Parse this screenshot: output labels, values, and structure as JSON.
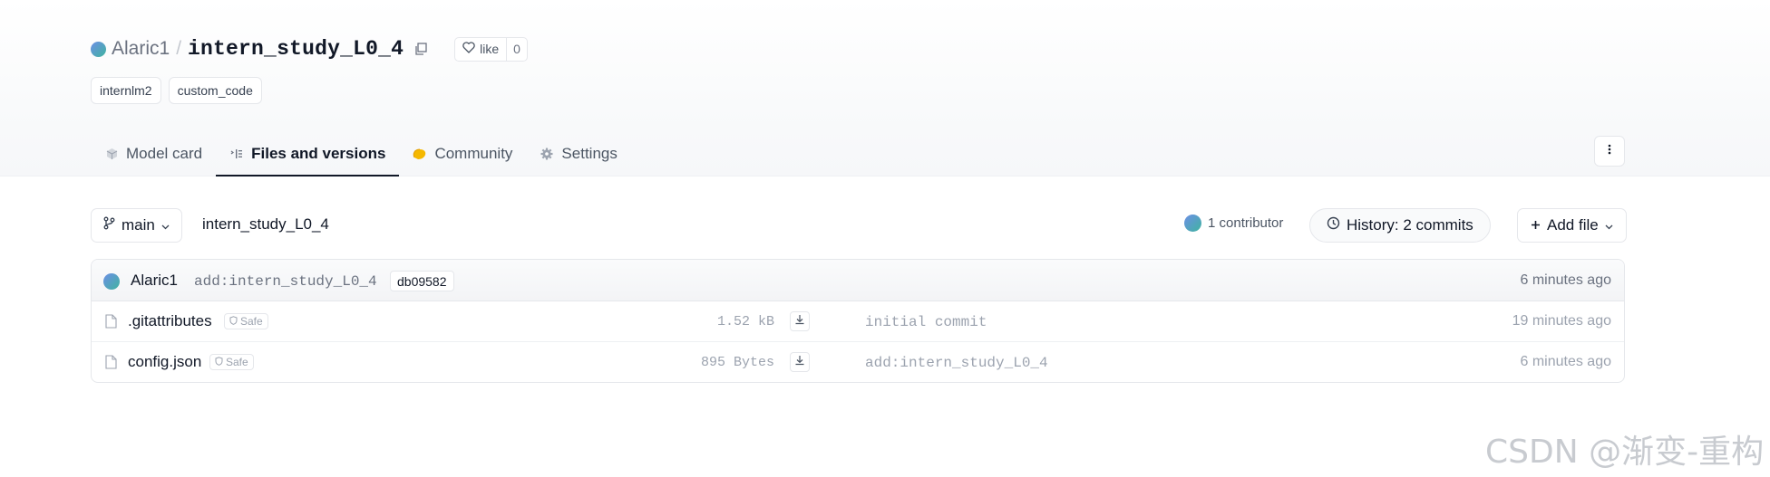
{
  "repo": {
    "owner": "Alaric1",
    "separator": "/",
    "name": "intern_study_L0_4",
    "like_label": "like",
    "like_count": "0"
  },
  "tags": [
    "internlm2",
    "custom_code"
  ],
  "tabs": [
    {
      "label": "Model card",
      "icon": "cube-icon"
    },
    {
      "label": "Files and versions",
      "icon": "files-icon",
      "active": true
    },
    {
      "label": "Community",
      "icon": "community-icon"
    },
    {
      "label": "Settings",
      "icon": "gear-icon"
    }
  ],
  "toolbar": {
    "branch": "main",
    "path": "intern_study_L0_4",
    "contributors": "1 contributor",
    "history": "History: 2 commits",
    "add_file": "Add file"
  },
  "last_commit": {
    "author": "Alaric1",
    "message": "add:intern_study_L0_4",
    "hash": "db09582",
    "time": "6 minutes ago"
  },
  "files": [
    {
      "name": ".gitattributes",
      "badge": "Safe",
      "size": "1.52 kB",
      "commit": "initial commit",
      "time": "19 minutes ago"
    },
    {
      "name": "config.json",
      "badge": "Safe",
      "size": "895 Bytes",
      "commit": "add:intern_study_L0_4",
      "time": "6 minutes ago"
    }
  ],
  "watermark": "CSDN @渐变-重构",
  "colors": {
    "accent": "#111827",
    "avatar_gradient_start": "#6d8fe6",
    "avatar_gradient_end": "#3fb3a0",
    "community_icon": "#f5b800"
  }
}
